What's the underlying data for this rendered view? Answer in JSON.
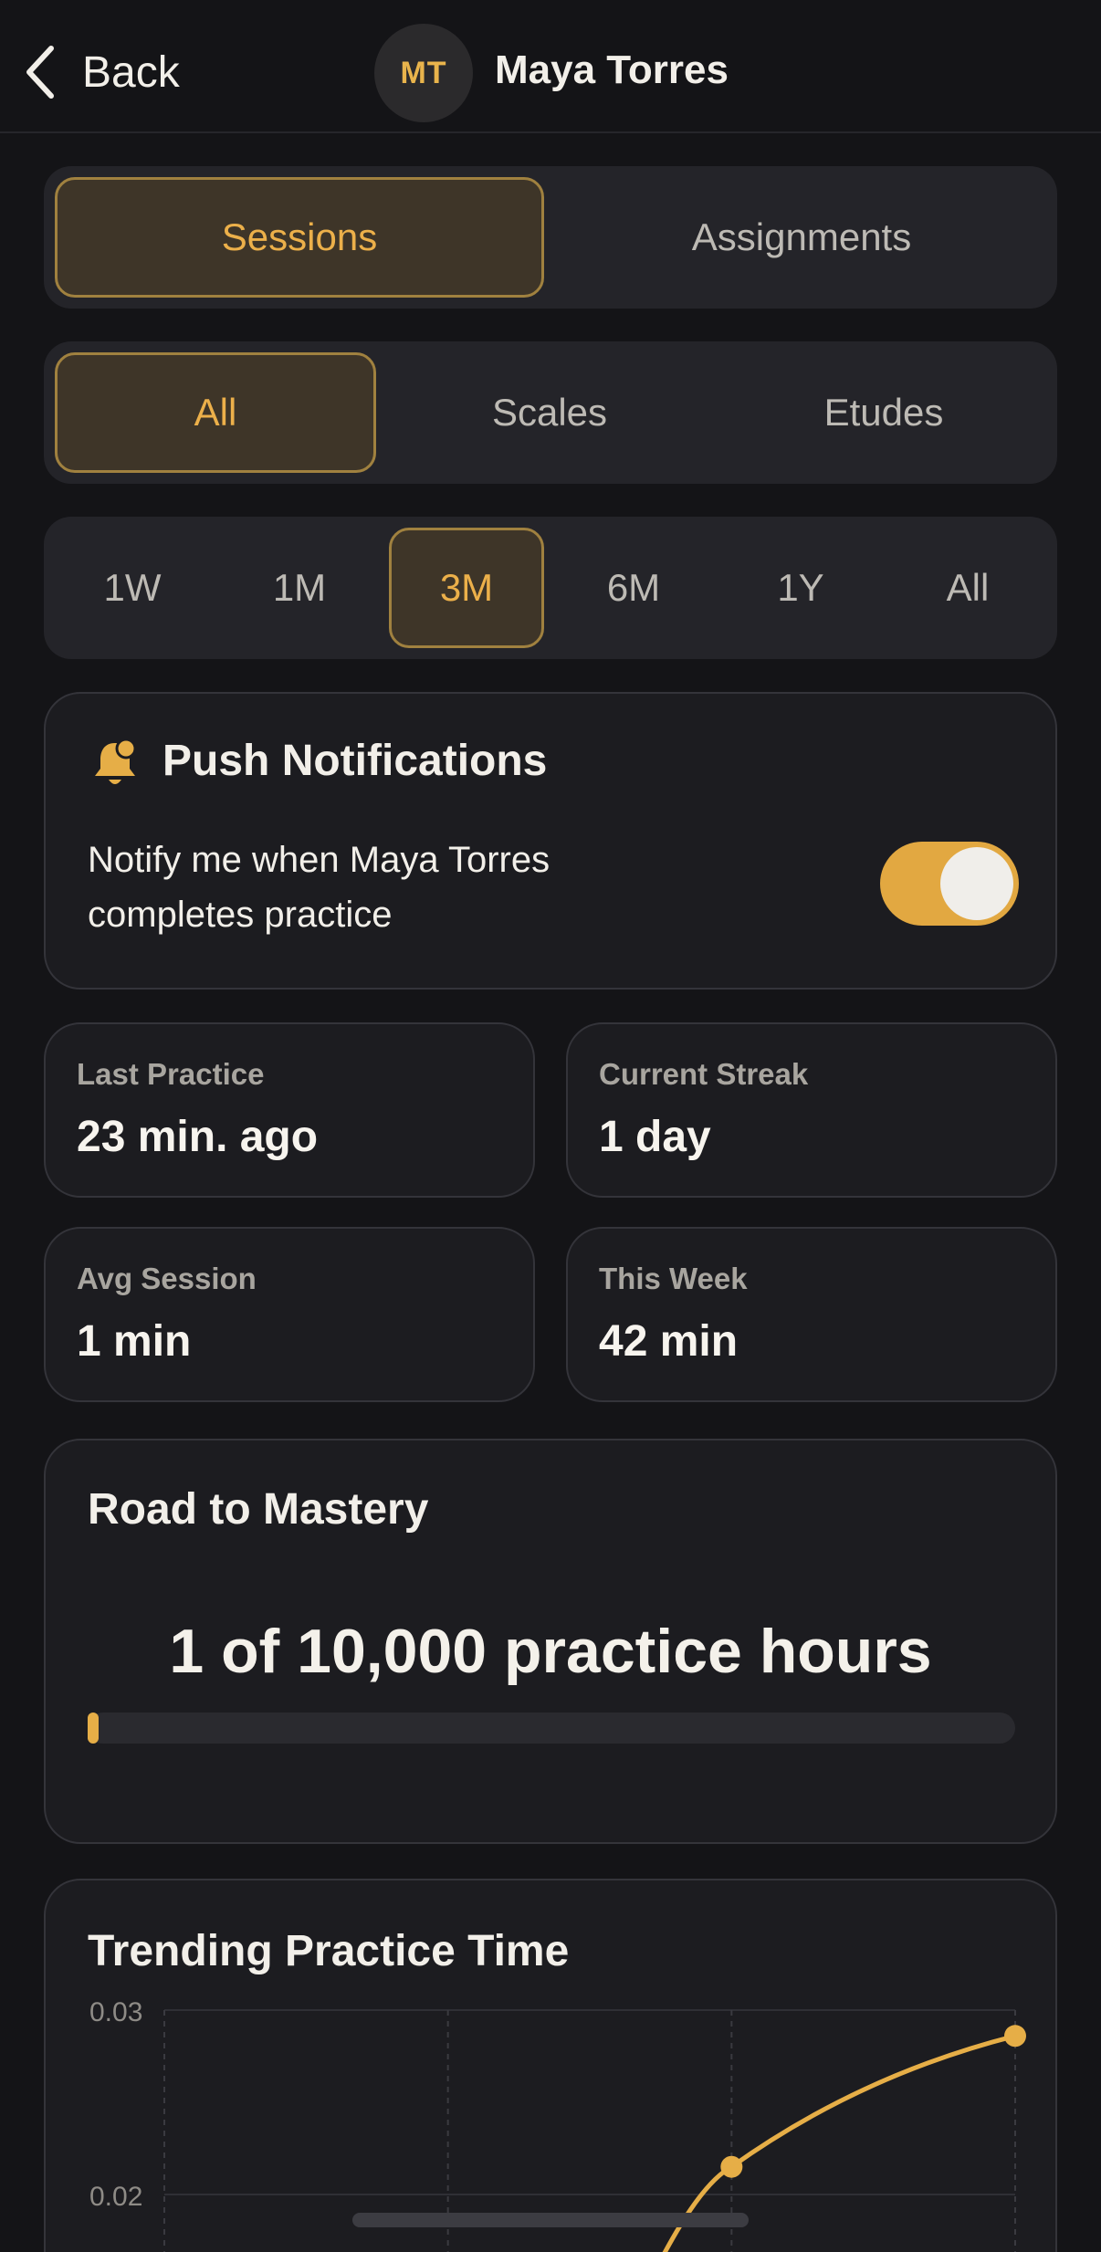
{
  "header": {
    "back_label": "Back",
    "avatar_initials": "MT",
    "student_name": "Maya Torres"
  },
  "view_tabs": [
    {
      "label": "Sessions",
      "active": true
    },
    {
      "label": "Assignments",
      "active": false
    }
  ],
  "category_tabs": [
    {
      "label": "All",
      "active": true
    },
    {
      "label": "Scales",
      "active": false
    },
    {
      "label": "Etudes",
      "active": false
    }
  ],
  "range_tabs": [
    {
      "label": "1W",
      "active": false
    },
    {
      "label": "1M",
      "active": false
    },
    {
      "label": "3M",
      "active": true
    },
    {
      "label": "6M",
      "active": false
    },
    {
      "label": "1Y",
      "active": false
    },
    {
      "label": "All",
      "active": false
    }
  ],
  "notifications": {
    "title": "Push Notifications",
    "line1": "Notify me when Maya Torres",
    "line2": "completes practice",
    "enabled": true,
    "icon": "bell-icon"
  },
  "stats": [
    {
      "label": "Last Practice",
      "value": "23 min. ago"
    },
    {
      "label": "Current Streak",
      "value": "1 day"
    },
    {
      "label": "Avg Session",
      "value": "1 min"
    },
    {
      "label": "This Week",
      "value": "42 min"
    }
  ],
  "mastery": {
    "title": "Road to Mastery",
    "summary": "1 of 10,000 practice hours",
    "progress": 0.0001
  },
  "trend": {
    "title": "Trending Practice Time"
  },
  "colors": {
    "accent": "#e6ae47",
    "background": "#141417",
    "card": "#1c1c20"
  },
  "chart_data": {
    "type": "line",
    "title": "Trending Practice Time",
    "xlabel": "",
    "ylabel": "",
    "y_ticks": [
      "0.03",
      "0.02"
    ],
    "ylim": [
      0.01,
      0.03
    ],
    "grid": true,
    "series": [
      {
        "x": [
          2,
          3
        ],
        "values": [
          0.0215,
          0.0286
        ]
      }
    ],
    "partial_curve_points": [
      0.0185,
      0.0215,
      0.0286
    ]
  }
}
